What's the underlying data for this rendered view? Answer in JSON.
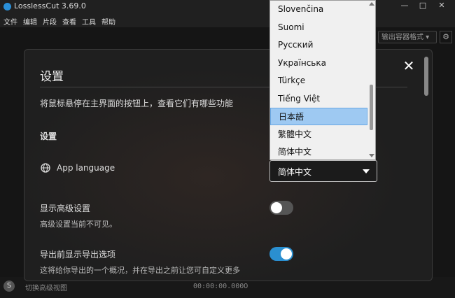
{
  "window": {
    "title": "LosslessCut 3.69.0",
    "minimize": "—",
    "maximize": "□",
    "close": "✕"
  },
  "menu": [
    "文件",
    "编辑",
    "片段",
    "查看",
    "工具",
    "帮助"
  ],
  "toolbar": {
    "format_label": "输出容器格式 ▾",
    "gear_icon": "⚙"
  },
  "bottom": {
    "toggle_label": "切换高级视图",
    "time": "00:00:00.000",
    "zero": "0"
  },
  "settings": {
    "title": "设置",
    "close": "✕",
    "hint": "将鼠标悬停在主界面的按钮上，查看它们有哪些功能",
    "section": "设置",
    "language_label": "App language",
    "language_value": "简体中文",
    "advanced_title": "显示高级设置",
    "advanced_desc": "高级设置当前不可见。",
    "advanced_on": false,
    "export_title": "导出前显示导出选项",
    "export_desc": "这将给你导出的一个概况，并在导出之前让您可自定义更多",
    "export_on": true
  },
  "dropdown": {
    "items": [
      "Slovenčina",
      "Suomi",
      "Русский",
      "Українська",
      "Türkçe",
      "Tiếng Việt",
      "日本語",
      "繁體中文",
      "简体中文"
    ],
    "selected_index": 6
  },
  "colors": {
    "accent": "#2a8fd0",
    "highlight": "#9ec9f2"
  }
}
